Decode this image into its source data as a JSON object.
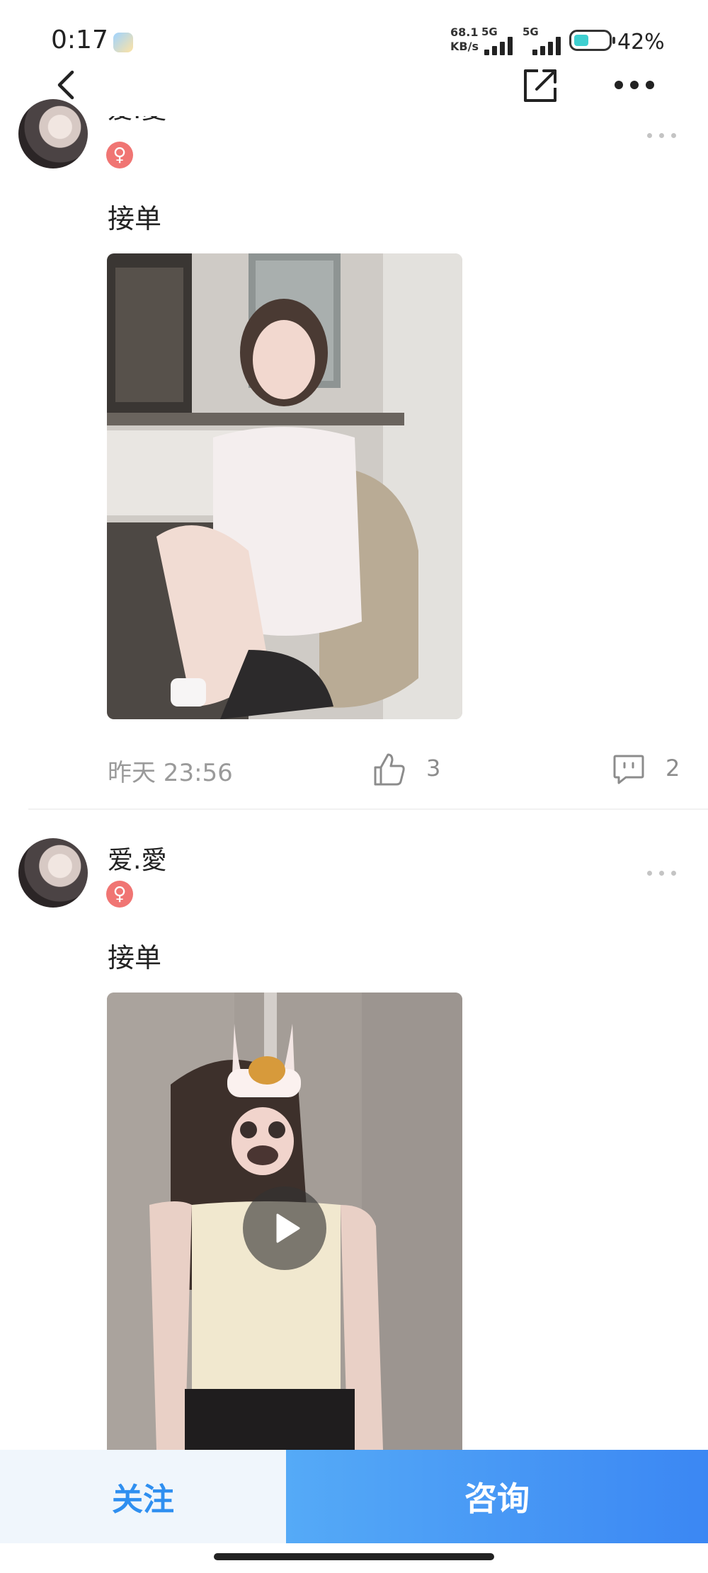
{
  "status_bar": {
    "time": "0:17",
    "net_speed_value": "68.1",
    "net_speed_unit": "KB/s",
    "sim1_label": "5G",
    "sim2_label": "5G",
    "battery_percent": "42%",
    "battery_level": 0.42,
    "battery_color": "#3ecfd0"
  },
  "nav": {
    "back_icon": "chevron-left-icon",
    "share_icon": "share-external-icon",
    "more_icon": "more-horizontal-icon"
  },
  "posts": [
    {
      "username": "爱.愛",
      "gender_symbol": "♀",
      "text": "接单",
      "media_type": "photo",
      "time": "昨天 23:56",
      "likes": "3",
      "comments": "2"
    },
    {
      "username": "爱.愛",
      "gender_symbol": "♀",
      "text": "接单",
      "media_type": "video"
    }
  ],
  "bottom_bar": {
    "follow_label": "关注",
    "consult_label": "咨询",
    "accent_color": "#2f8ff0"
  }
}
